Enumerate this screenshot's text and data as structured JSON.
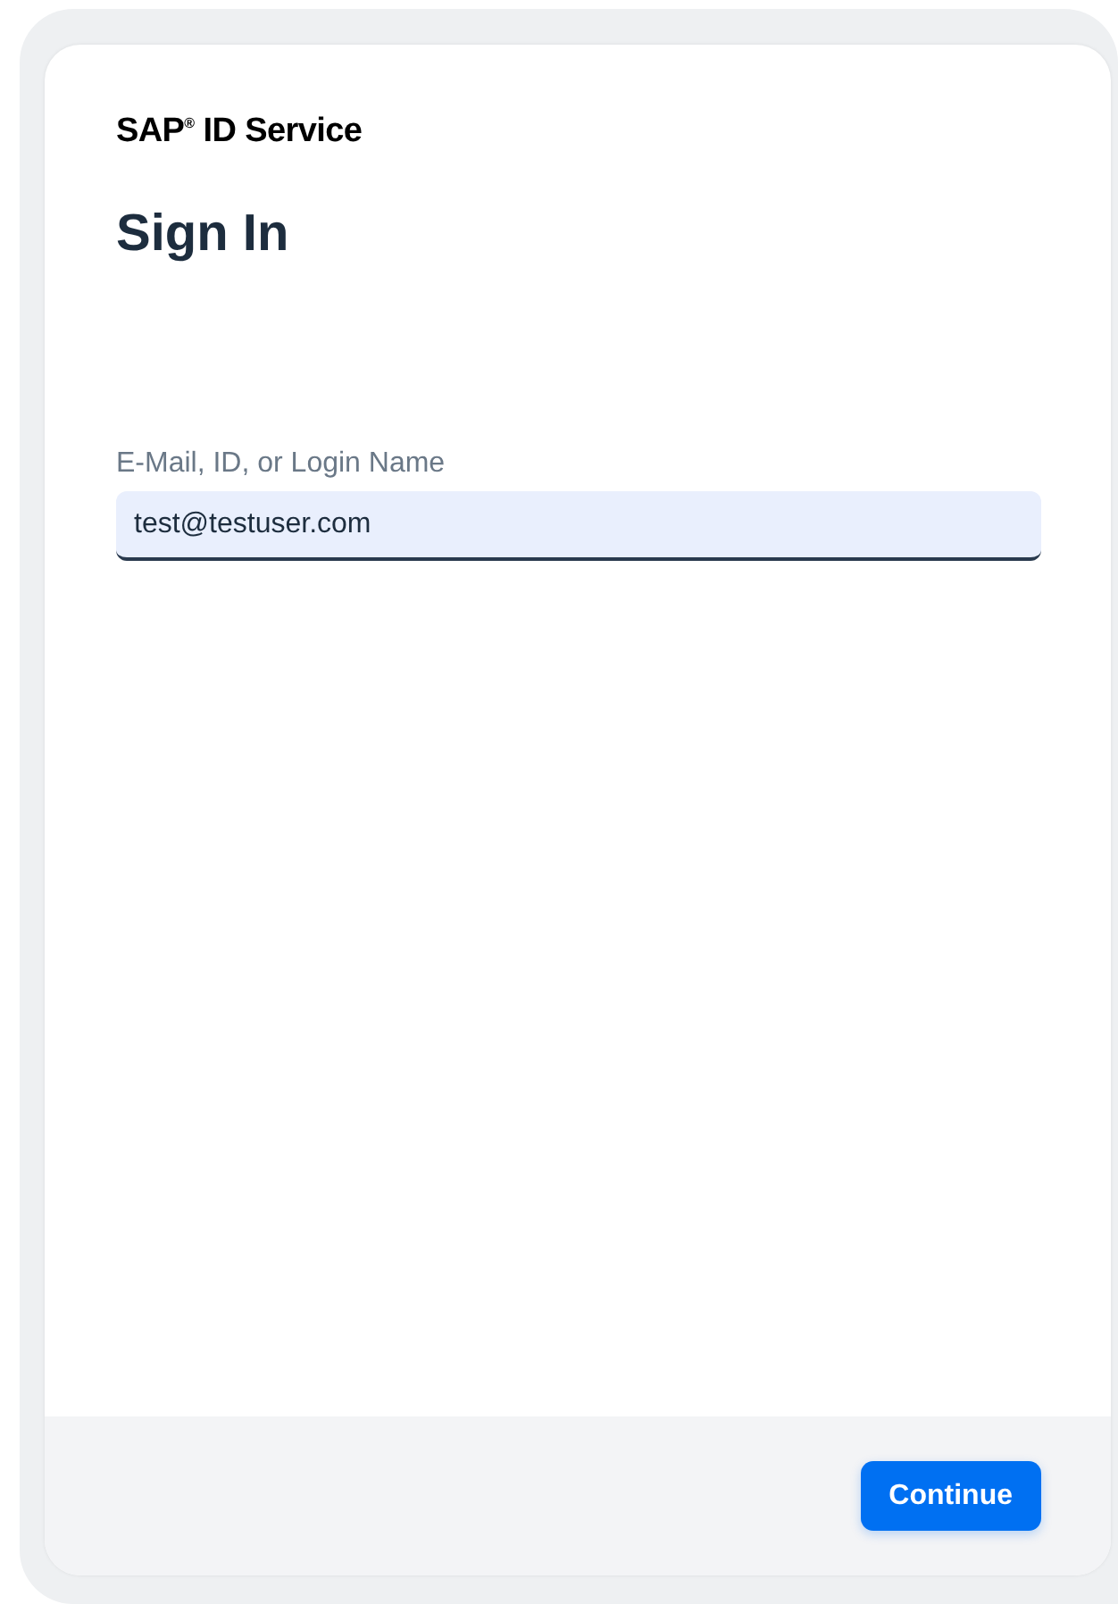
{
  "brand": "SAP$^{®}$ ID Service",
  "title": "Sign In",
  "login_field": {
    "label": "E-Mail, ID, or Login Name",
    "value": "test@testuser.com"
  },
  "buttons": [
    {
      "label": "Continue",
      "kind": "primary"
    }
  ]
}
